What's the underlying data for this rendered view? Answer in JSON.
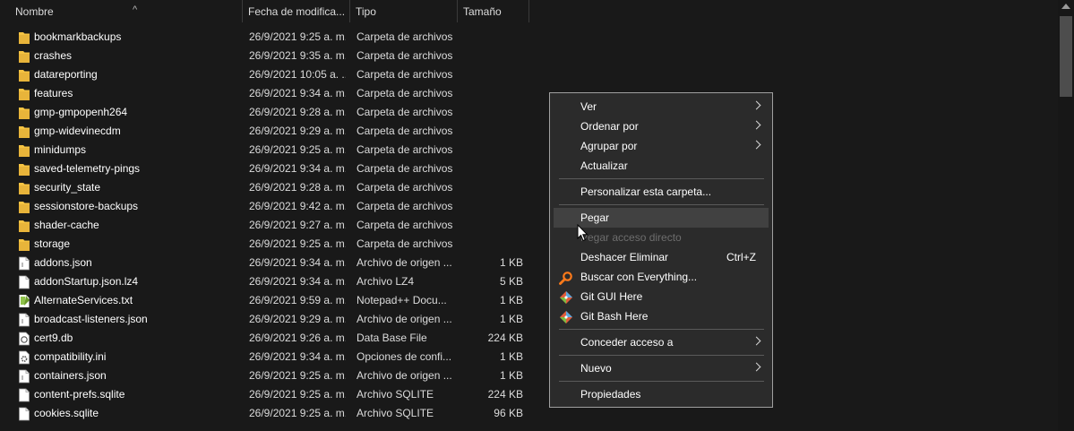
{
  "columns": {
    "name": "Nombre",
    "date": "Fecha de modifica...",
    "type": "Tipo",
    "size": "Tamaño"
  },
  "files": [
    {
      "name": "bookmarkbackups",
      "date": "26/9/2021 9:25 a. m.",
      "type": "Carpeta de archivos",
      "size": "",
      "icon": "folder-icon"
    },
    {
      "name": "crashes",
      "date": "26/9/2021 9:35 a. m.",
      "type": "Carpeta de archivos",
      "size": "",
      "icon": "folder-icon"
    },
    {
      "name": "datareporting",
      "date": "26/9/2021 10:05 a. ...",
      "type": "Carpeta de archivos",
      "size": "",
      "icon": "folder-icon"
    },
    {
      "name": "features",
      "date": "26/9/2021 9:34 a. m.",
      "type": "Carpeta de archivos",
      "size": "",
      "icon": "folder-icon"
    },
    {
      "name": "gmp-gmpopenh264",
      "date": "26/9/2021 9:28 a. m.",
      "type": "Carpeta de archivos",
      "size": "",
      "icon": "folder-icon"
    },
    {
      "name": "gmp-widevinecdm",
      "date": "26/9/2021 9:29 a. m.",
      "type": "Carpeta de archivos",
      "size": "",
      "icon": "folder-icon"
    },
    {
      "name": "minidumps",
      "date": "26/9/2021 9:25 a. m.",
      "type": "Carpeta de archivos",
      "size": "",
      "icon": "folder-icon"
    },
    {
      "name": "saved-telemetry-pings",
      "date": "26/9/2021 9:34 a. m.",
      "type": "Carpeta de archivos",
      "size": "",
      "icon": "folder-icon"
    },
    {
      "name": "security_state",
      "date": "26/9/2021 9:28 a. m.",
      "type": "Carpeta de archivos",
      "size": "",
      "icon": "folder-icon"
    },
    {
      "name": "sessionstore-backups",
      "date": "26/9/2021 9:42 a. m.",
      "type": "Carpeta de archivos",
      "size": "",
      "icon": "folder-icon"
    },
    {
      "name": "shader-cache",
      "date": "26/9/2021 9:27 a. m.",
      "type": "Carpeta de archivos",
      "size": "",
      "icon": "folder-icon"
    },
    {
      "name": "storage",
      "date": "26/9/2021 9:25 a. m.",
      "type": "Carpeta de archivos",
      "size": "",
      "icon": "folder-icon"
    },
    {
      "name": "addons.json",
      "date": "26/9/2021 9:34 a. m.",
      "type": "Archivo de origen ...",
      "size": "1 KB",
      "icon": "json-file-icon"
    },
    {
      "name": "addonStartup.json.lz4",
      "date": "26/9/2021 9:34 a. m.",
      "type": "Archivo LZ4",
      "size": "5 KB",
      "icon": "file-icon"
    },
    {
      "name": "AlternateServices.txt",
      "date": "26/9/2021 9:59 a. m.",
      "type": "Notepad++ Docu...",
      "size": "1 KB",
      "icon": "notepadpp-file-icon"
    },
    {
      "name": "broadcast-listeners.json",
      "date": "26/9/2021 9:29 a. m.",
      "type": "Archivo de origen ...",
      "size": "1 KB",
      "icon": "json-file-icon"
    },
    {
      "name": "cert9.db",
      "date": "26/9/2021 9:26 a. m.",
      "type": "Data Base File",
      "size": "224 KB",
      "icon": "database-file-icon"
    },
    {
      "name": "compatibility.ini",
      "date": "26/9/2021 9:34 a. m.",
      "type": "Opciones de confi...",
      "size": "1 KB",
      "icon": "settings-file-icon"
    },
    {
      "name": "containers.json",
      "date": "26/9/2021 9:25 a. m.",
      "type": "Archivo de origen ...",
      "size": "1 KB",
      "icon": "json-file-icon"
    },
    {
      "name": "content-prefs.sqlite",
      "date": "26/9/2021 9:25 a. m.",
      "type": "Archivo SQLITE",
      "size": "224 KB",
      "icon": "file-icon"
    },
    {
      "name": "cookies.sqlite",
      "date": "26/9/2021 9:25 a. m.",
      "type": "Archivo SQLITE",
      "size": "96 KB",
      "icon": "file-icon"
    }
  ],
  "context_menu": {
    "items": [
      {
        "kind": "item",
        "label": "Ver",
        "submenu": true
      },
      {
        "kind": "item",
        "label": "Ordenar por",
        "submenu": true
      },
      {
        "kind": "item",
        "label": "Agrupar por",
        "submenu": true
      },
      {
        "kind": "item",
        "label": "Actualizar"
      },
      {
        "kind": "sep"
      },
      {
        "kind": "item",
        "label": "Personalizar esta carpeta..."
      },
      {
        "kind": "sep"
      },
      {
        "kind": "item",
        "label": "Pegar",
        "highlight": true
      },
      {
        "kind": "item",
        "label": "Pegar acceso directo",
        "disabled": true
      },
      {
        "kind": "item",
        "label": "Deshacer Eliminar",
        "shortcut": "Ctrl+Z"
      },
      {
        "kind": "item",
        "label": "Buscar con Everything...",
        "icon": "search-everything-icon"
      },
      {
        "kind": "item",
        "label": "Git GUI Here",
        "icon": "git-icon"
      },
      {
        "kind": "item",
        "label": "Git Bash Here",
        "icon": "git-icon"
      },
      {
        "kind": "sep"
      },
      {
        "kind": "item",
        "label": "Conceder acceso a",
        "submenu": true
      },
      {
        "kind": "sep"
      },
      {
        "kind": "item",
        "label": "Nuevo",
        "submenu": true
      },
      {
        "kind": "sep"
      },
      {
        "kind": "item",
        "label": "Propiedades"
      }
    ]
  },
  "colors": {
    "background": "#191919",
    "folder": "#f5c342",
    "menu_bg": "#2b2b2b",
    "menu_highlight": "#414141",
    "disabled_text": "#6d6d6d"
  }
}
